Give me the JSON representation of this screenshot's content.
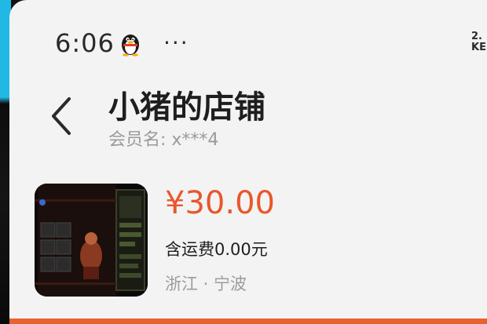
{
  "status_bar": {
    "time": "6:06",
    "more": "···",
    "net_speed_line1": "2.",
    "net_speed_line2": "KE"
  },
  "header": {
    "title": "小猪的店铺",
    "member_label": "会员名: x***4"
  },
  "product": {
    "price": "¥30.00",
    "shipping": "含运费0.00元",
    "location": "浙江 · 宁波"
  },
  "colors": {
    "price": "#e8572b",
    "accent_bar": "#e6622f"
  },
  "icons": {
    "back": "chevron-left-icon",
    "qq": "penguin-icon",
    "more": "more-icon"
  }
}
